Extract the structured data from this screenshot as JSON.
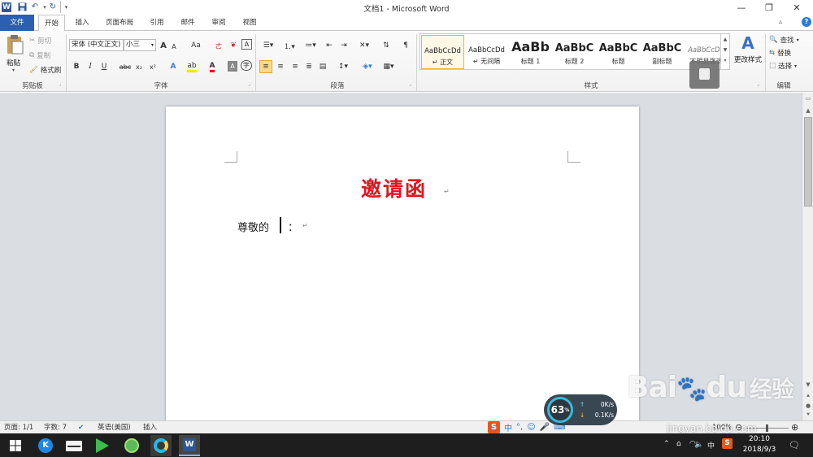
{
  "window": {
    "title": "文档1 - Microsoft Word",
    "minimize_glyph": "—",
    "restore_glyph": "❐",
    "close_glyph": "✕"
  },
  "quick_access": {
    "word_icon": "W",
    "save_icon": "save-icon",
    "undo_icon": "↶",
    "redo_icon": "↻",
    "customize_icon": "▾"
  },
  "tabs": [
    {
      "label": "文件"
    },
    {
      "label": "开始"
    },
    {
      "label": "插入"
    },
    {
      "label": "页面布局"
    },
    {
      "label": "引用"
    },
    {
      "label": "邮件"
    },
    {
      "label": "审阅"
    },
    {
      "label": "视图"
    }
  ],
  "ribbon": {
    "clipboard": {
      "paste": "粘贴",
      "cut": "剪切",
      "copy": "复制",
      "format_painter": "格式刷",
      "label": "剪贴板"
    },
    "font": {
      "font_name": "宋体 (中文正文)",
      "font_size": "小三",
      "grow": "A",
      "shrink": "A",
      "change_case": "Aa",
      "clear_format": "A",
      "bold": "B",
      "italic": "I",
      "underline": "U",
      "strike": "abc",
      "subscript": "x₂",
      "superscript": "x²",
      "label": "字体"
    },
    "paragraph": {
      "label": "段落"
    },
    "styles": {
      "label": "样式",
      "items": [
        {
          "sample": "AaBbCcDd",
          "name": "↵ 正文"
        },
        {
          "sample": "AaBbCcDd",
          "name": "↵ 无间隔"
        },
        {
          "sample": "AaBb",
          "name": "标题 1"
        },
        {
          "sample": "AaBbC",
          "name": "标题 2"
        },
        {
          "sample": "AaBbC",
          "name": "标题"
        },
        {
          "sample": "AaBbC",
          "name": "副标题"
        },
        {
          "sample": "AaBbCcDd",
          "name": "不明显强调"
        }
      ],
      "change_styles": "更改样式"
    },
    "editing": {
      "label": "编辑",
      "find": "查找",
      "replace": "替换",
      "select": "选择"
    }
  },
  "document": {
    "heading": "邀请函",
    "line1_prefix": "尊敬的",
    "line1_suffix": "：",
    "para_mark": "↵"
  },
  "status": {
    "page": "页面: 1/1",
    "words": "字数: 7",
    "language": "英语(美国)",
    "mode": "插入",
    "zoom": "100%"
  },
  "net_widget": {
    "percent": "63",
    "up": "0K/s",
    "down": "0.1K/s"
  },
  "watermark": {
    "brand": "Bai",
    "brand2": "du",
    "chinese": "经验",
    "url": "jingyan.baidu.com"
  },
  "taskbar": {
    "ime": "中",
    "time": "20:10",
    "date": "2018/9/3"
  },
  "colors": {
    "accent": "#2b579a",
    "file_tab": "#2b5fb3",
    "heading_red": "#e0141e"
  }
}
